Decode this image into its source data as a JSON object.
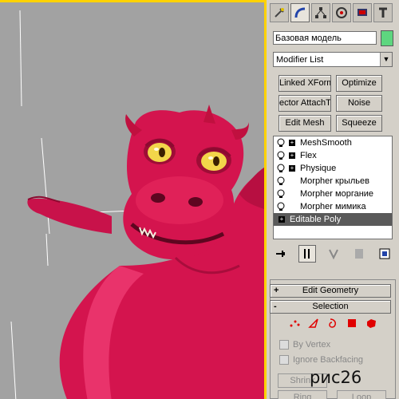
{
  "viewport": {
    "subject": "red cartoon dragon render"
  },
  "command_panel": {
    "tabs": [
      "create-icon",
      "modify-icon",
      "hierarchy-icon",
      "motion-icon",
      "display-icon",
      "utilities-icon"
    ],
    "object_name": "Базовая модель",
    "object_color": "#5ed67f",
    "modifier_list_label": "Modifier List",
    "modifier_buttons": [
      {
        "label": "Linked XForm"
      },
      {
        "label": "Optimize"
      },
      {
        "label": "ector AttachTo"
      },
      {
        "label": "Noise"
      },
      {
        "label": "Edit Mesh"
      },
      {
        "label": "Squeeze"
      }
    ],
    "stack": [
      {
        "label": "MeshSmooth",
        "expand": "+"
      },
      {
        "label": "Flex",
        "expand": "+"
      },
      {
        "label": "Physique",
        "expand": "+"
      },
      {
        "label": "Morpher крыльев"
      },
      {
        "label": "Morpher моргание"
      },
      {
        "label": "Morpher мимика"
      },
      {
        "label": "Editable Poly",
        "selected": true
      }
    ]
  },
  "rollouts": {
    "edit_geometry": {
      "sign": "+",
      "label": "Edit Geometry"
    },
    "selection": {
      "sign": "-",
      "label": "Selection"
    },
    "by_vertex_label": "By Vertex",
    "ignore_backfacing_label": "Ignore Backfacing",
    "shrink_label": "Shrink",
    "ring_label": "Ring",
    "loop_label": "Loop"
  },
  "figure_caption": "рис26",
  "colors": {
    "viewport_bg": "#a2a2a2",
    "active_border": "#ffd200",
    "dragon": "#d4144e",
    "panel_bg": "#d4d0c8",
    "subobject_red": "#e00000"
  }
}
